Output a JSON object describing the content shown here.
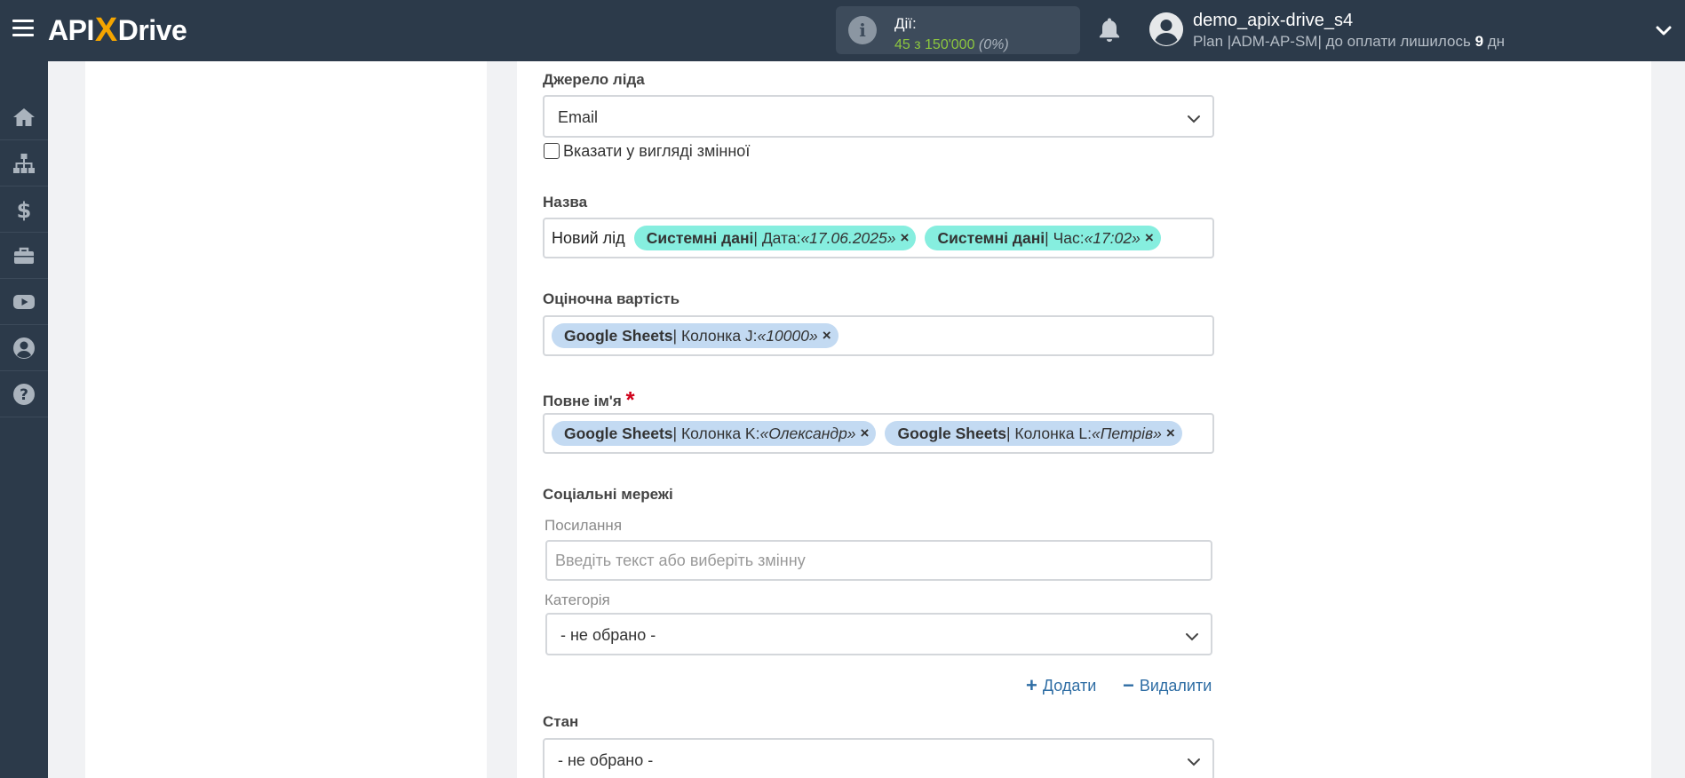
{
  "header": {
    "logo": {
      "before": "API",
      "x": "X",
      "after": "Drive"
    },
    "actions": {
      "label": "Дії:",
      "count": "45 з 150'000",
      "percent": "(0%)"
    },
    "user": {
      "name": "demo_apix-drive_s4",
      "plan_prefix": "Plan |ADM-AP-SM| до оплати лишилось",
      "days": "9",
      "days_unit": "дн"
    }
  },
  "sidebar": {
    "items": [
      {
        "icon": "home-icon"
      },
      {
        "icon": "sitemap-icon"
      },
      {
        "icon": "dollar-icon"
      },
      {
        "icon": "briefcase-icon"
      },
      {
        "icon": "youtube-icon"
      },
      {
        "icon": "user-circle-icon"
      },
      {
        "icon": "question-circle-icon"
      }
    ]
  },
  "form": {
    "lead_source": {
      "label": "Джерело ліда",
      "value": "Email",
      "checkbox_label": "Вказати у вигляді змінної"
    },
    "name": {
      "label": "Назва",
      "plain_text": "Новий лід",
      "tags": [
        {
          "source": "Системні дані",
          "field": " | Дата: ",
          "value": "«17.06.2025»",
          "remove": "×"
        },
        {
          "source": "Системні дані",
          "field": " | Час: ",
          "value": "«17:02»",
          "remove": "×"
        }
      ]
    },
    "estimated_value": {
      "label": "Оціночна вартість",
      "tags": [
        {
          "source": "Google Sheets",
          "field": " | Колонка J: ",
          "value": "«10000»",
          "remove": "×"
        }
      ]
    },
    "full_name": {
      "label": "Повне ім'я",
      "required_mark": "*",
      "tags": [
        {
          "source": "Google Sheets",
          "field": " | Колонка K: ",
          "value": "«Олександр»",
          "remove": "×"
        },
        {
          "source": "Google Sheets",
          "field": " | Колонка L: ",
          "value": "«Петрів»",
          "remove": "×"
        }
      ]
    },
    "social": {
      "label": "Соціальні мережі",
      "link_label": "Посилання",
      "link_placeholder": "Введіть текст або виберіть змінну",
      "category_label": "Категорія",
      "category_value": "- не обрано -",
      "add_label": "Додати",
      "remove_label": "Видалити"
    },
    "status": {
      "label": "Стан",
      "value": "- не обрано -"
    }
  },
  "colors": {
    "topbar": "#2c3a4a",
    "accent_orange": "#f5a500",
    "count_green": "#8cc63f",
    "system_tag": "#86eedf",
    "sheets_tag": "#c3daf2",
    "link_blue": "#2e6da4",
    "required_red": "#d0021b"
  }
}
